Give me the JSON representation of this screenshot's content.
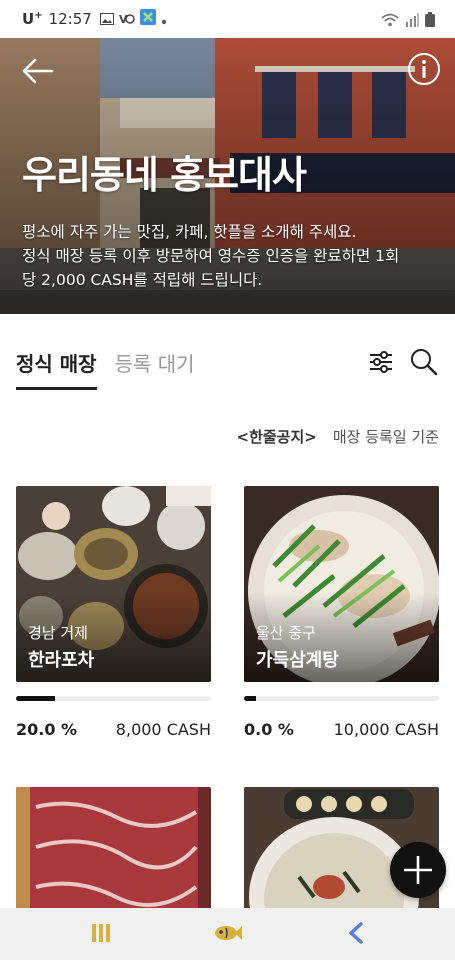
{
  "status_bar": {
    "carrier": "U",
    "carrier_sup": "+",
    "time": "12:57"
  },
  "hero": {
    "title": "우리동네 홍보대사",
    "description_line1": "평소에 자주 가는 맛집, 카페, 핫플을 소개해 주세요.",
    "description_line2": "정식 매장 등록 이후 방문하여 영수증 인증을 완료하면 1회",
    "description_line3": "당 2,000 CASH를 적립해 드립니다."
  },
  "tabs": [
    {
      "label": "정식 매장",
      "active": true
    },
    {
      "label": "등록 대기",
      "active": false
    }
  ],
  "notice": {
    "link": "<한줄공지>",
    "sort": "매장 등록일 기준"
  },
  "stores": [
    {
      "region": "경남 거제",
      "name": "한라포차",
      "progress": 20.0,
      "percent_text": "20.0 %",
      "reward": "8,000 CASH"
    },
    {
      "region": "울산 중구",
      "name": "가득삼계탕",
      "progress": 0.0,
      "percent_text": "0.0 %",
      "reward": "10,000 CASH"
    },
    {
      "region": "",
      "name": "",
      "progress": null,
      "percent_text": "",
      "reward": ""
    },
    {
      "region": "",
      "name": "",
      "progress": null,
      "percent_text": "",
      "reward": ""
    }
  ],
  "icons": {
    "back": "arrow-left-icon",
    "info": "info-icon",
    "filter": "filter-sliders-icon",
    "search": "search-icon",
    "add": "plus-icon",
    "nav_recent": "recent-apps-icon",
    "nav_home": "fish-home-icon",
    "nav_back": "chevron-left-icon"
  },
  "colors": {
    "accent": "#111111",
    "nav_icon": "#d8b23a",
    "nav_back": "#5b7fd6"
  }
}
